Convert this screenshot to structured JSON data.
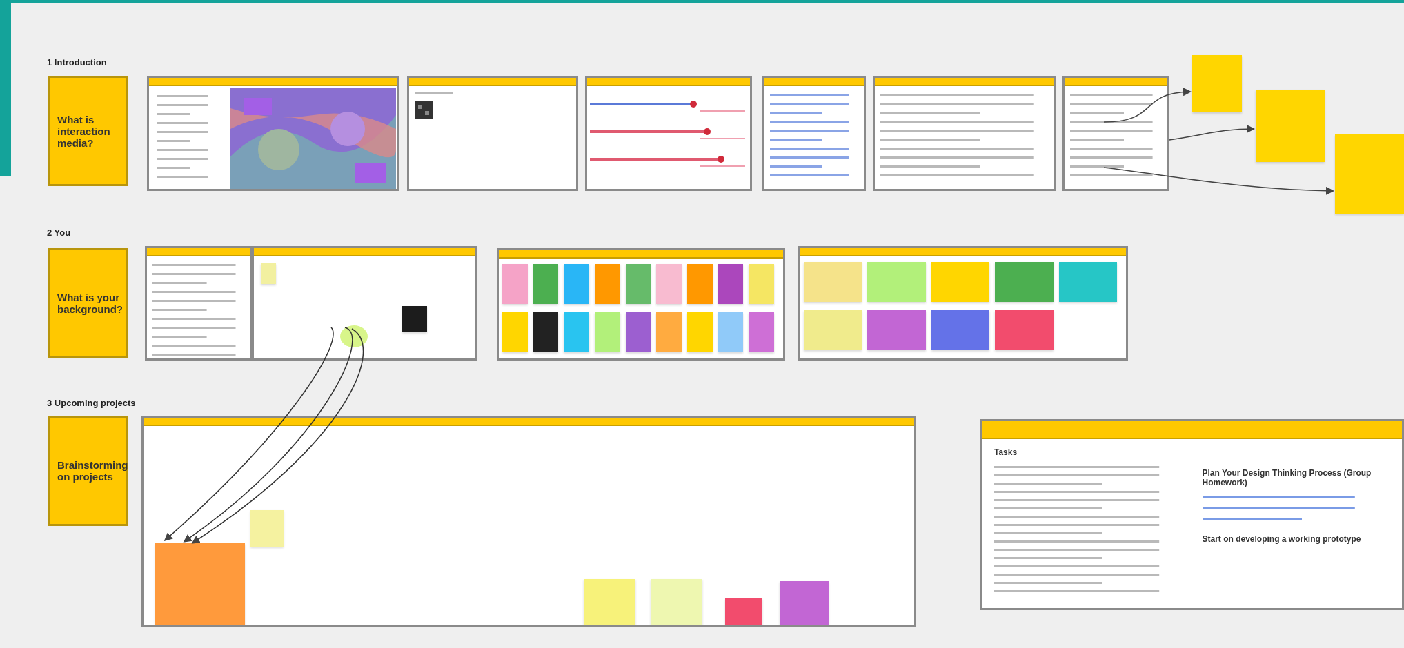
{
  "sections": [
    {
      "title": "1 Introduction",
      "prompt": "What is interaction media?"
    },
    {
      "title": "2 You",
      "prompt": "What is your background?"
    },
    {
      "title": "3 Upcoming projects",
      "prompt": "Brainstorming on projects"
    }
  ],
  "frames": [
    {
      "kind": "slides"
    },
    {
      "kind": "qr"
    },
    {
      "kind": "timeline"
    },
    {
      "kind": "links"
    },
    {
      "kind": "notes"
    },
    {
      "kind": "list"
    },
    {
      "kind": "notes"
    },
    {
      "kind": "board"
    },
    {
      "kind": "stickies",
      "notes": [
        {
          "color": "#f5a3c7"
        },
        {
          "color": "#4caf50"
        },
        {
          "color": "#29b6f6"
        },
        {
          "color": "#ff9800"
        },
        {
          "color": "#66bb6a"
        },
        {
          "color": "#f8bbd0"
        },
        {
          "color": "#ff9800"
        },
        {
          "color": "#ab47bc"
        },
        {
          "color": "#f5e663"
        },
        {
          "color": "#ffd600"
        },
        {
          "color": "#222222"
        },
        {
          "color": "#29c4f0"
        },
        {
          "color": "#b2f07a"
        },
        {
          "color": "#9c5fd0"
        },
        {
          "color": "#ffab40"
        },
        {
          "color": "#ffd600"
        },
        {
          "color": "#90caf9"
        },
        {
          "color": "#ce6fd6"
        }
      ]
    },
    {
      "kind": "stickies",
      "notes": [
        {
          "color": "#f5e38a"
        },
        {
          "color": "#b2f07a"
        },
        {
          "color": "#ffd600"
        },
        {
          "color": "#4caf50"
        },
        {
          "color": "#26c6c6"
        },
        {
          "color": "#f0eb8c"
        },
        {
          "color": "#c266d4"
        },
        {
          "color": "#6472e8"
        },
        {
          "color": "#f24c6d"
        }
      ]
    },
    {
      "kind": "brainstorm"
    }
  ],
  "side_stickies": [
    {
      "color": "#ffd600"
    },
    {
      "color": "#ffd600"
    },
    {
      "color": "#ffd600"
    }
  ],
  "brainstorm_stickies": [
    {
      "color": "#ff9a3c"
    },
    {
      "color": "#f5f2a0"
    },
    {
      "color": "#f7f27a"
    },
    {
      "color": "#eef7b0"
    },
    {
      "color": "#f24c6d"
    },
    {
      "color": "#c266d4"
    }
  ],
  "tasks_panel": {
    "heading": "Tasks",
    "homework_title": "Plan Your Design Thinking Process (Group Homework)",
    "next_step": "Start on developing a working prototype"
  }
}
